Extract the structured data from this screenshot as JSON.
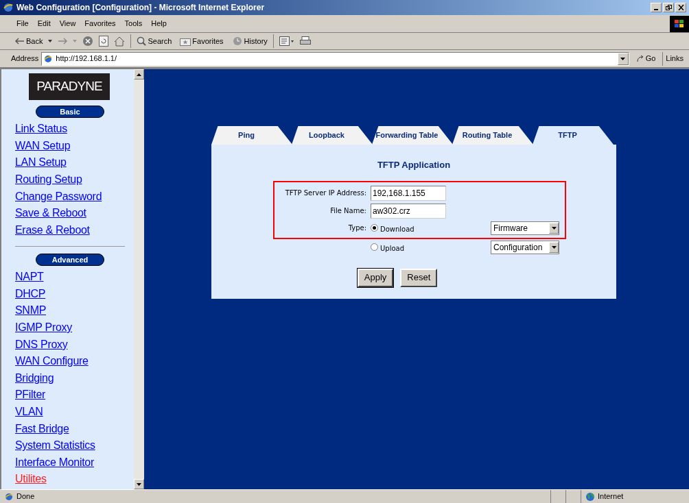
{
  "window": {
    "title": "Web Configuration [Configuration] - Microsoft Internet Explorer"
  },
  "menu": [
    "File",
    "Edit",
    "View",
    "Favorites",
    "Tools",
    "Help"
  ],
  "toolbar": {
    "back": "Back",
    "search": "Search",
    "favorites": "Favorites",
    "history": "History"
  },
  "address_bar": {
    "label": "Address",
    "value": "http://192.168.1.1/",
    "go": "Go",
    "links": "Links"
  },
  "sidebar": {
    "logo": "PARADYNE",
    "sections": [
      {
        "heading": "Basic",
        "items": [
          {
            "label": "Link Status",
            "selected": false
          },
          {
            "label": "WAN Setup",
            "selected": false
          },
          {
            "label": "LAN Setup",
            "selected": false
          },
          {
            "label": "Routing Setup",
            "selected": false
          },
          {
            "label": "Change Password",
            "selected": false
          },
          {
            "label": "Save & Reboot",
            "selected": false
          },
          {
            "label": "Erase & Reboot",
            "selected": false
          }
        ]
      },
      {
        "heading": "Advanced",
        "items": [
          {
            "label": "NAPT",
            "selected": false
          },
          {
            "label": "DHCP",
            "selected": false
          },
          {
            "label": "SNMP",
            "selected": false
          },
          {
            "label": "IGMP Proxy",
            "selected": false
          },
          {
            "label": "DNS Proxy",
            "selected": false
          },
          {
            "label": "WAN Configure",
            "selected": false
          },
          {
            "label": "Bridging",
            "selected": false
          },
          {
            "label": "PFilter",
            "selected": false
          },
          {
            "label": "VLAN",
            "selected": false
          },
          {
            "label": "Fast Bridge",
            "selected": false
          },
          {
            "label": "System Statistics",
            "selected": false
          },
          {
            "label": "Interface Monitor",
            "selected": false
          },
          {
            "label": "Utilites",
            "selected": true
          }
        ]
      }
    ]
  },
  "tabs": [
    {
      "label": "Ping",
      "selected": false
    },
    {
      "label": "Loopback",
      "selected": false
    },
    {
      "label": "Forwarding Table",
      "selected": false
    },
    {
      "label": "Routing Table",
      "selected": false
    },
    {
      "label": "TFTP",
      "selected": true
    }
  ],
  "form": {
    "title": "TFTP Application",
    "fields": [
      {
        "label": "TFTP Server IP Address:",
        "value": "192,168.1.155"
      },
      {
        "label": "File Name:",
        "value": "aw302.crz"
      }
    ],
    "type_label": "Type:",
    "options": [
      {
        "label": "Download",
        "selected": true,
        "select_value": "Firmware"
      },
      {
        "label": "Upload",
        "selected": false,
        "select_value": "Configuration"
      }
    ],
    "buttons": [
      "Apply",
      "Reset"
    ]
  },
  "status_bar": {
    "text": "Done",
    "zone": "Internet"
  }
}
